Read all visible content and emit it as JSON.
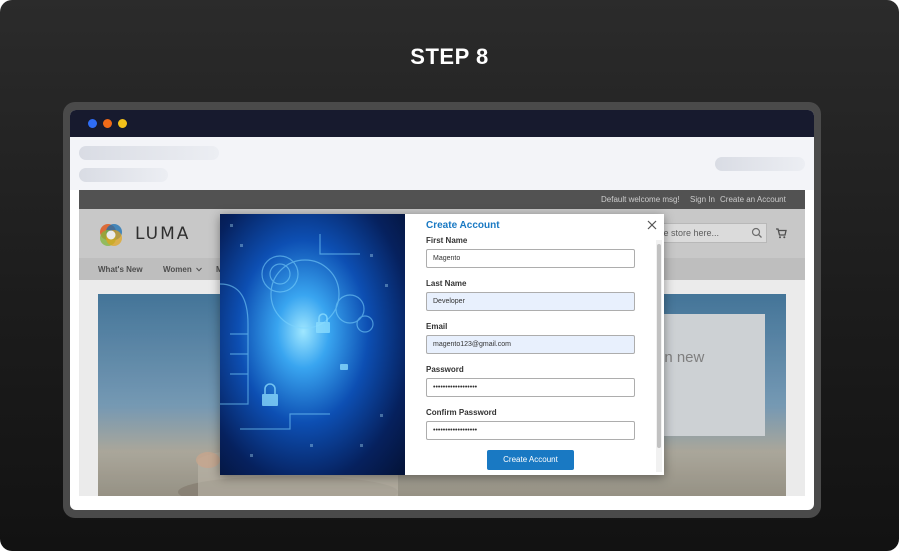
{
  "page": {
    "step_title": "STEP 8"
  },
  "site": {
    "topbar": {
      "welcome": "Default welcome msg!",
      "sign_in": "Sign In",
      "create_account": "Create an Account"
    },
    "logo_text": "LUMA",
    "search_placeholder": "entire store here...",
    "nav": [
      "What's New",
      "Women",
      "M"
    ],
    "hero_text": "in new"
  },
  "modal": {
    "title": "Create Account",
    "fields": [
      {
        "label": "First Name",
        "value": "Magento"
      },
      {
        "label": "Last Name",
        "value": "Developer"
      },
      {
        "label": "Email",
        "value": "magento123@gmail.com"
      },
      {
        "label": "Password",
        "value": "••••••••••••••••••"
      },
      {
        "label": "Confirm Password",
        "value": "••••••••••••••••••"
      }
    ],
    "submit_label": "Create Account"
  },
  "colors": {
    "accent": "#1979c3",
    "titlebar": "#171a2e",
    "dot_blue": "#2f6df5",
    "dot_orange": "#f06a18",
    "dot_yellow": "#f4c21a"
  },
  "icons": [
    "close-icon",
    "search-icon",
    "cart-icon",
    "chevron-down-icon"
  ]
}
